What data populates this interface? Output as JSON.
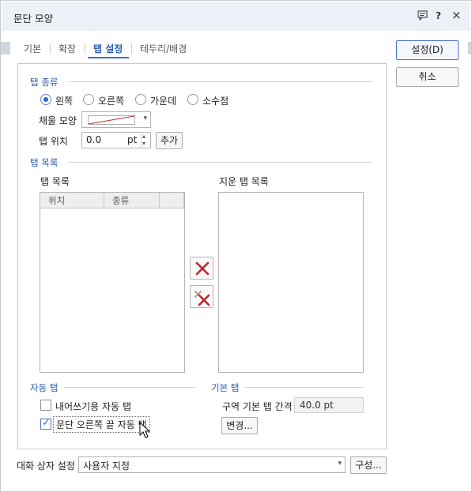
{
  "window": {
    "title": "문단 모양",
    "help_glyph": "?",
    "close_glyph": "×",
    "comment_icon": "comment-icon"
  },
  "tabs": [
    {
      "label": "기본",
      "active": false
    },
    {
      "label": "확장",
      "active": false
    },
    {
      "label": "탭 설정",
      "active": true
    },
    {
      "label": "테두리/배경",
      "active": false
    }
  ],
  "actions": {
    "ok_label": "설정(D)",
    "cancel_label": "취소"
  },
  "tab_type": {
    "section_label": "탭 종류",
    "options": [
      {
        "label": "왼쪽",
        "checked": true
      },
      {
        "label": "오른쪽",
        "checked": false
      },
      {
        "label": "가운데",
        "checked": false
      },
      {
        "label": "소수점",
        "checked": false
      }
    ],
    "fill_label": "채울 모양",
    "position_label": "탭 위치",
    "position_value": "0.0",
    "position_unit": "pt",
    "add_label": "추가"
  },
  "tab_list": {
    "section_label": "탭 목록",
    "list_label": "탭 목록",
    "columns": [
      "위치",
      "종류",
      ""
    ],
    "deleted_list_label": "지운 탭 목록"
  },
  "auto_tab": {
    "section_label": "자동 탭",
    "hanging_label": "내어쓰기용 자동 탭",
    "hanging_checked": false,
    "right_end_label": "문단 오른쪽 끝 자동 탭",
    "right_end_checked": true
  },
  "default_tab": {
    "section_label": "기본 탭",
    "interval_label": "구역 기본 탭 간격",
    "interval_value": "40.0 pt",
    "change_label": "변경..."
  },
  "dialog_setting": {
    "label": "대화 상자 설정",
    "value": "사용자 지정",
    "configure_label": "구성..."
  },
  "colors": {
    "accent": "#2d5db2",
    "delete_red": "#c0282c"
  }
}
